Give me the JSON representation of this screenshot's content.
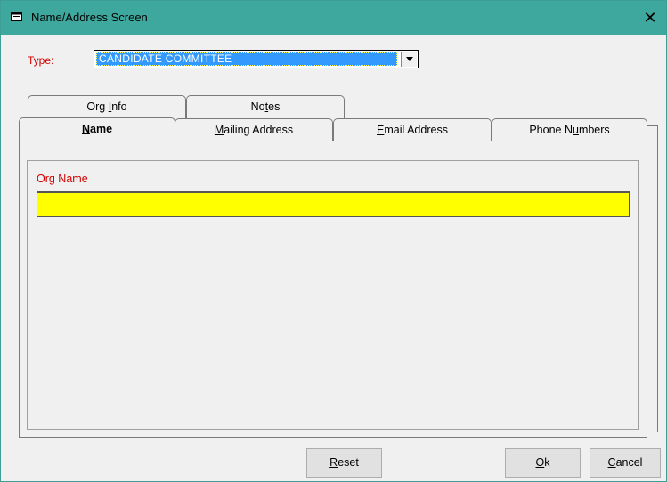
{
  "window": {
    "title": "Name/Address Screen",
    "icon": "window-app-icon",
    "close_glyph": "✕"
  },
  "type_field": {
    "label": "Type:",
    "selected_value": "CANDIDATE COMMITTEE"
  },
  "tabs": {
    "back_row": [
      {
        "label_pre": "Org ",
        "label_u": "I",
        "label_post": "nfo"
      },
      {
        "label_pre": "No",
        "label_u": "t",
        "label_post": "es"
      }
    ],
    "front_row": [
      {
        "label_pre": "",
        "label_u": "N",
        "label_post": "ame",
        "active": true
      },
      {
        "label_pre": "",
        "label_u": "M",
        "label_post": "ailing Address"
      },
      {
        "label_pre": "",
        "label_u": "E",
        "label_post": "mail Address"
      },
      {
        "label_pre": "Phone N",
        "label_u": "u",
        "label_post": "mbers"
      }
    ]
  },
  "name_panel": {
    "org_name_label": "Org Name",
    "org_name_value": ""
  },
  "buttons": {
    "reset": {
      "pre": "",
      "u": "R",
      "post": "eset"
    },
    "ok": {
      "pre": "",
      "u": "O",
      "post": "k"
    },
    "cancel": {
      "pre": "",
      "u": "C",
      "post": "ancel"
    }
  },
  "colors": {
    "titlebar": "#3fa89e",
    "label_red": "#d00000",
    "selection_blue": "#3399ff",
    "required_yellow": "#ffff00"
  }
}
